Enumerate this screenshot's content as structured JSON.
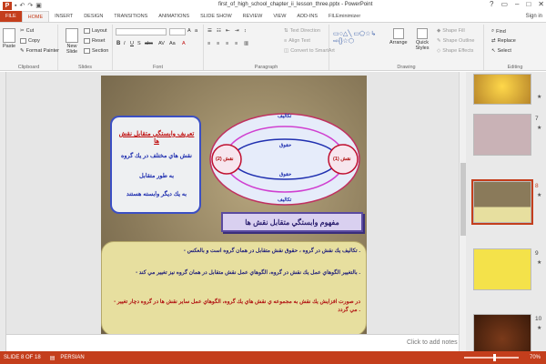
{
  "window": {
    "title": "first_of_high_school_chapter_ii_lesson_three.pptx - PowerPoint",
    "signin": "Sign in"
  },
  "tabs": [
    "FILE",
    "HOME",
    "INSERT",
    "DESIGN",
    "TRANSITIONS",
    "ANIMATIONS",
    "SLIDE SHOW",
    "REVIEW",
    "VIEW",
    "ADD-INS",
    "FILEminimizer"
  ],
  "ribbon": {
    "clipboard": {
      "paste": "Paste",
      "cut": "Cut",
      "copy": "Copy",
      "format_painter": "Format Painter",
      "label": "Clipboard"
    },
    "slides": {
      "new_slide": "New Slide",
      "layout": "Layout",
      "reset": "Reset",
      "section": "Section",
      "label": "Slides"
    },
    "font": {
      "label": "Font"
    },
    "paragraph": {
      "text_direction": "Text Direction",
      "align_text": "Align Text",
      "convert_smartart": "Convert to SmartArt",
      "label": "Paragraph"
    },
    "drawing": {
      "arrange": "Arrange",
      "quick_styles": "Quick Styles",
      "shape_fill": "Shape Fill",
      "shape_outline": "Shape Outline",
      "shape_effects": "Shape Effects",
      "label": "Drawing"
    },
    "editing": {
      "find": "Find",
      "replace": "Replace",
      "select": "Select",
      "label": "Editing"
    }
  },
  "slide": {
    "stone_title": "تعريف وابستگي متقابل نقش ها",
    "stone_line1": "نقش هاي مختلف در يك گروه",
    "stone_line2": "به طور متقابل",
    "stone_line3": "به يك ديگر وابسته هستند",
    "diag_top": "تكاليف",
    "diag_rights_upper": "حقوق",
    "diag_role2": "نقش (2)",
    "diag_role1": "نقش (1)",
    "diag_rights_lower": "حقوق",
    "diag_bottom": "تكاليف",
    "heading": "مفهوم وابستگي متقابل نقش ها",
    "para1": "- تكاليف يك نقش در گروه ، حقوق نقش متقابل در همان گروه است و بالعكس .",
    "para2": "- بالتغيير الگوهاي عمل يك نقش در گروه، الگوهاي عمل نقش متقابل در همان گروه نيز تغيير مي كند .",
    "para3": "- در صورت افزايش يك نقش به مجموعه ي نقش هاي يك گروه، الگوهاي عمل ساير نقش ها در گروه دچار تغيير مي گردد ."
  },
  "notes_placeholder": "Click to add notes",
  "thumbnails": [
    {
      "num": "",
      "star": "★"
    },
    {
      "num": "7",
      "star": "★"
    },
    {
      "num": "8",
      "star": "★"
    },
    {
      "num": "9",
      "star": "★"
    },
    {
      "num": "10",
      "star": "★"
    }
  ],
  "status": {
    "slide_info": "SLIDE 8 OF 18",
    "language": "PERSIAN",
    "zoom": "70%"
  },
  "colors": {
    "accent": "#c43e1c"
  }
}
